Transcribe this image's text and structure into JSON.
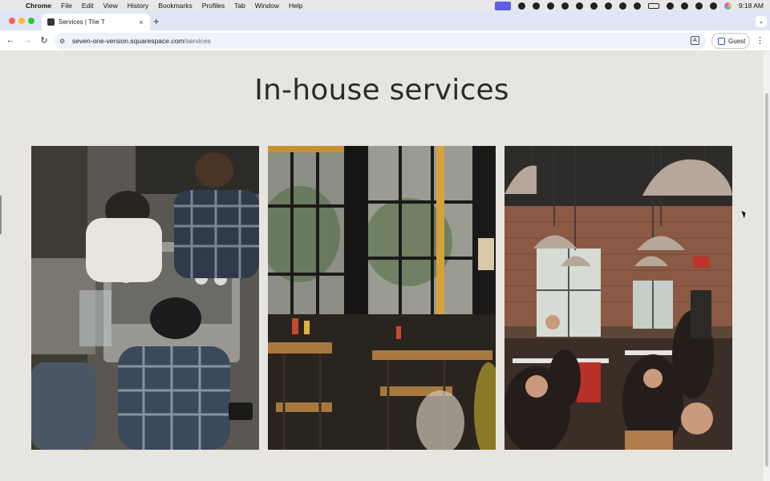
{
  "menubar": {
    "app": "Chrome",
    "items": [
      "File",
      "Edit",
      "View",
      "History",
      "Bookmarks",
      "Profiles",
      "Tab",
      "Window",
      "Help"
    ],
    "time": "9:18 AM"
  },
  "tab": {
    "title": "Services | The T",
    "close_glyph": "×",
    "new_tab_glyph": "+"
  },
  "toolbar": {
    "back": "←",
    "forward": "→",
    "reload": "↻",
    "url_host": "seven-one-version.squarespace.com",
    "url_path": "/services",
    "profile_label": "Guest",
    "menu_glyph": "⋮"
  },
  "page": {
    "title": "In-house services"
  },
  "colors": {
    "page_bg": "#e6e5e0",
    "tabstrip_bg": "#dfe6f6",
    "accent": "#5b5fe6"
  }
}
